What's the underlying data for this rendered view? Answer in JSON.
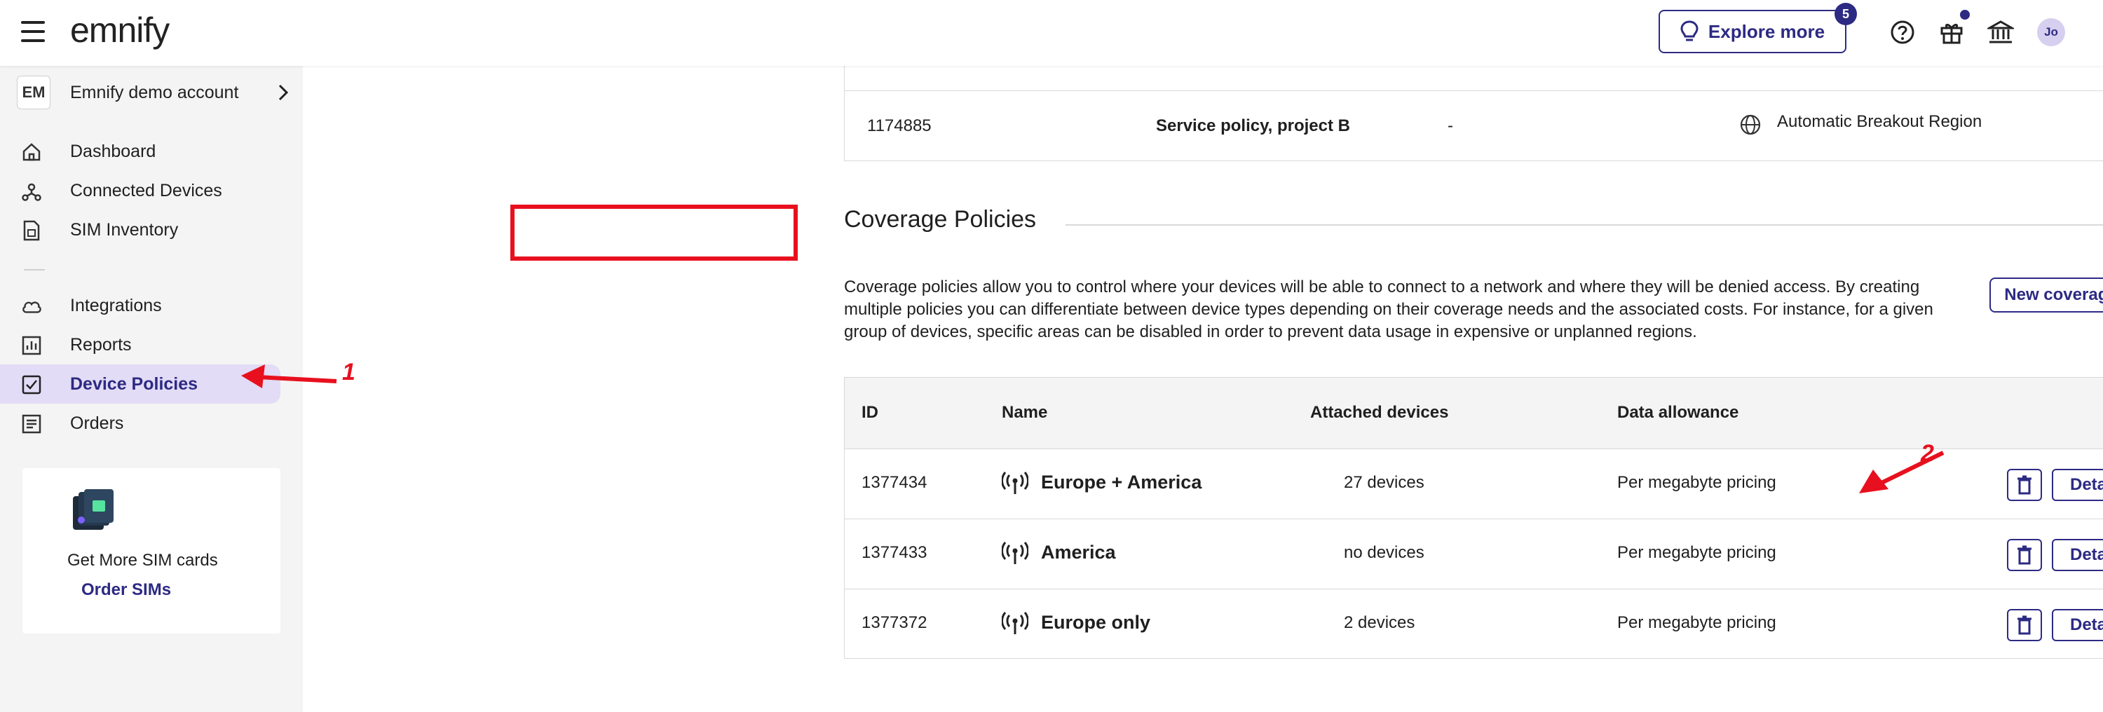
{
  "topbar": {
    "logo": "emnify",
    "explore_label": "Explore more",
    "explore_badge": "5",
    "avatar": "Jo"
  },
  "sidebar": {
    "account_initials": "EM",
    "account_name": "Emnify demo account",
    "items": [
      {
        "label": "Dashboard",
        "icon": "home-icon"
      },
      {
        "label": "Connected Devices",
        "icon": "connected-devices-icon"
      },
      {
        "label": "SIM Inventory",
        "icon": "sim-icon"
      },
      {
        "label": "Integrations",
        "icon": "cloud-icon"
      },
      {
        "label": "Reports",
        "icon": "reports-icon"
      },
      {
        "label": "Device Policies",
        "icon": "policy-check-icon",
        "active": true
      },
      {
        "label": "Orders",
        "icon": "orders-icon"
      }
    ],
    "sim_card": {
      "title": "Get More SIM cards",
      "link": "Order SIMs"
    }
  },
  "prev_table": {
    "row": {
      "id": "1174885",
      "name": "Service policy, project B",
      "devices": "-",
      "region": "Automatic Breakout Region"
    }
  },
  "coverage": {
    "title": "Coverage Policies",
    "description": "Coverage policies allow you to control where your devices will be able to connect to a network and where they will be denied access. By creating multiple policies you can differentiate between device types depending on their coverage needs and the associated costs. For instance, for a given group of devices, specific areas can be disabled in order to prevent data usage in expensive or unplanned regions.",
    "new_button": "New coverage policy",
    "columns": [
      "ID",
      "Name",
      "Attached devices",
      "Data allowance"
    ],
    "rows": [
      {
        "id": "1377434",
        "name": "Europe + America",
        "devices": "27 devices",
        "allowance": "Per megabyte pricing",
        "details": "Details"
      },
      {
        "id": "1377433",
        "name": "America",
        "devices": "no devices",
        "allowance": "Per megabyte pricing",
        "details": "Details"
      },
      {
        "id": "1377372",
        "name": "Europe only",
        "devices": "2 devices",
        "allowance": "Per megabyte pricing",
        "details": "Details"
      }
    ]
  },
  "annotations": {
    "one": "1",
    "two": "2",
    "color": "#e8101e"
  },
  "colors": {
    "accent": "#2d2a83",
    "active_bg": "#e2dcf6",
    "sidebar_bg": "#f4f4f4"
  }
}
